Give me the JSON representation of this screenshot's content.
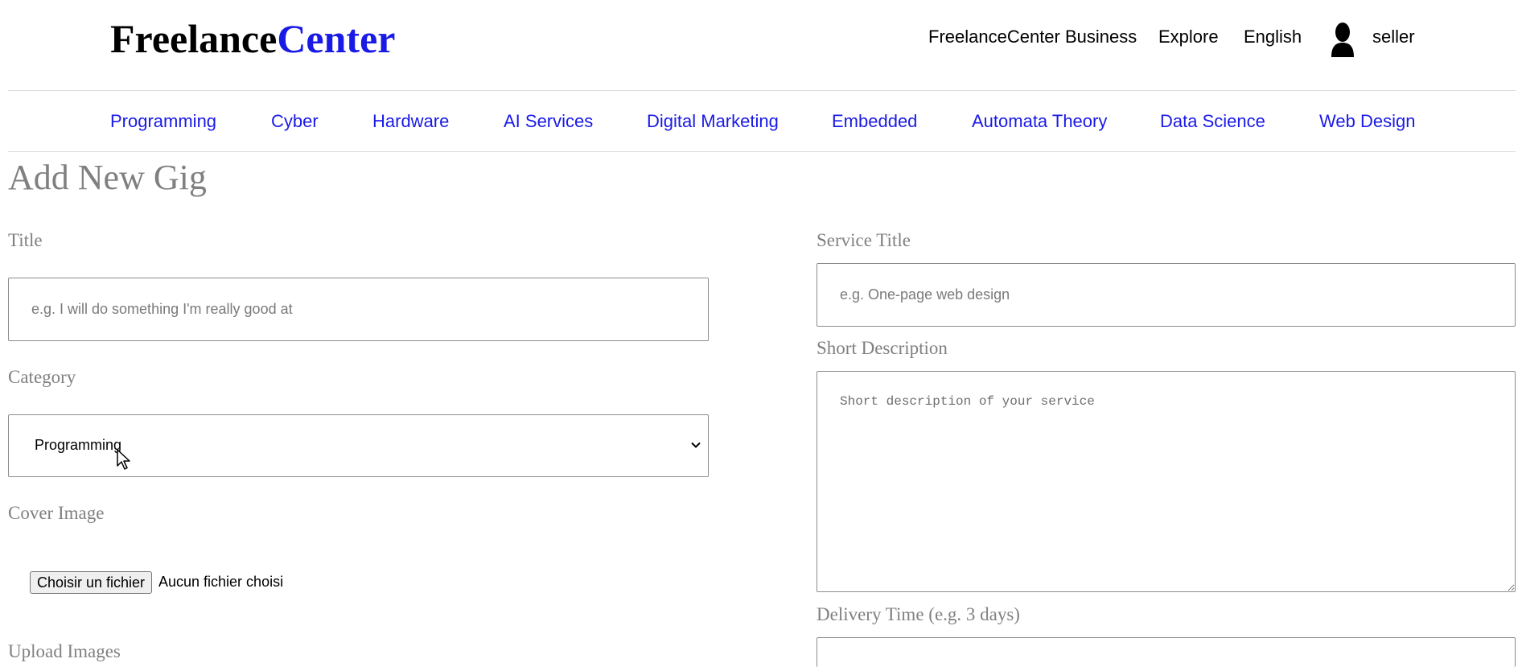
{
  "header": {
    "logo_part1": "Freelance",
    "logo_part2": "Center",
    "links": {
      "business": "FreelanceCenter Business",
      "explore": "Explore",
      "language": "English",
      "username": "seller"
    },
    "avatar_icon": "user-silhouette-icon"
  },
  "categories_nav": [
    "Programming",
    "Cyber",
    "Hardware",
    "AI Services",
    "Digital Marketing",
    "Embedded",
    "Automata Theory",
    "Data Science",
    "Web Design"
  ],
  "page": {
    "title": "Add New Gig"
  },
  "form_left": {
    "title_label": "Title",
    "title_placeholder": "e.g. I will do something I'm really good at",
    "title_value": "",
    "category_label": "Category",
    "category_selected": "Programming",
    "cover_label": "Cover Image",
    "file_button_label": "Choisir un fichier",
    "file_status": "Aucun fichier choisi",
    "upload_label": "Upload Images"
  },
  "form_right": {
    "service_title_label": "Service Title",
    "service_title_placeholder": "e.g. One-page web design",
    "service_title_value": "",
    "short_desc_label": "Short Description",
    "short_desc_placeholder": "Short description of your service",
    "short_desc_value": "",
    "delivery_label": "Delivery Time (e.g. 3 days)",
    "delivery_value": ""
  },
  "colors": {
    "brand_blue": "#1a1ae6",
    "label_gray": "#808080",
    "border_gray": "#8c8c8c"
  }
}
